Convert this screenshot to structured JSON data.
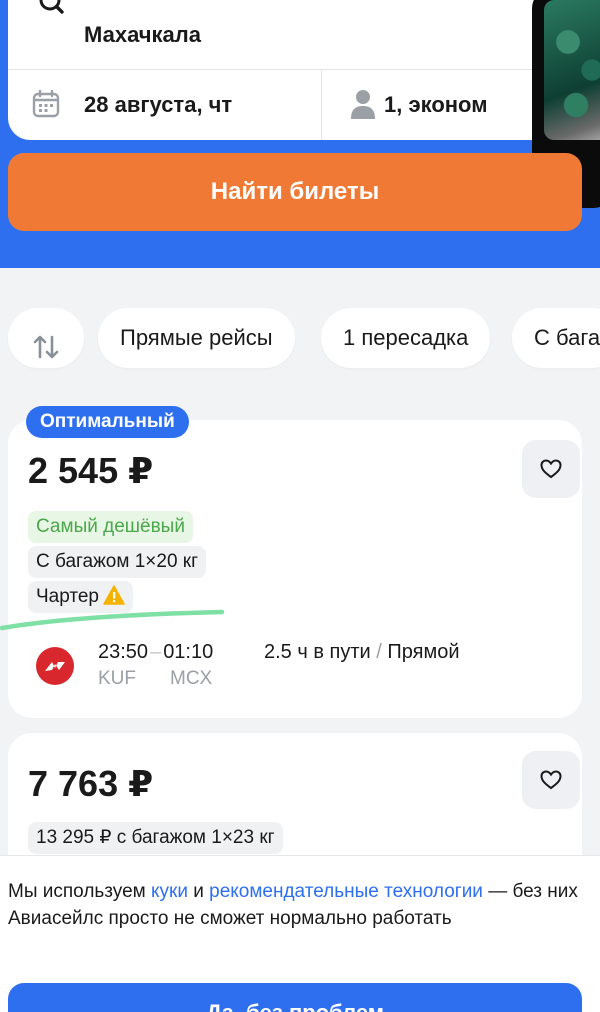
{
  "search": {
    "destination": "Махачкала",
    "date": "28 августа, чт",
    "passengers": "1, эконом",
    "find_button": "Найти билеты"
  },
  "filters": {
    "chips": [
      "Прямые рейсы",
      "1 пересадка",
      "С бага"
    ]
  },
  "results": [
    {
      "badge": "Оптимальный",
      "price": "2 545 ₽",
      "tags": [
        "Самый дешёвый",
        "С багажом 1×20 кг",
        "Чартер"
      ],
      "depart_time": "23:50",
      "arrive_time": "01:10",
      "depart_code": "KUF",
      "arrive_code": "MCX",
      "duration": "2.5 ч в пути",
      "route_type": "Прямой"
    },
    {
      "price": "7 763 ₽",
      "tags": [
        "13 295 ₽ с багажом 1×23 кг"
      ]
    }
  ],
  "cookie": {
    "text_1": "Мы используем ",
    "link_1": "куки",
    "text_2": " и ",
    "link_2": "рекомендательные технологии",
    "text_3": " — без них Авиасейлс просто не сможет нормально работать",
    "button": "Да, без проблем"
  },
  "colors": {
    "brand_blue": "#2e6ff0",
    "cta_orange": "#f07a35",
    "cheap_green": "#4aa84a",
    "airline_red": "#d9272e"
  },
  "icons": [
    "search-icon",
    "calendar-icon",
    "person-icon",
    "sort-icon",
    "heart-icon",
    "warning-icon",
    "airline-logo"
  ]
}
